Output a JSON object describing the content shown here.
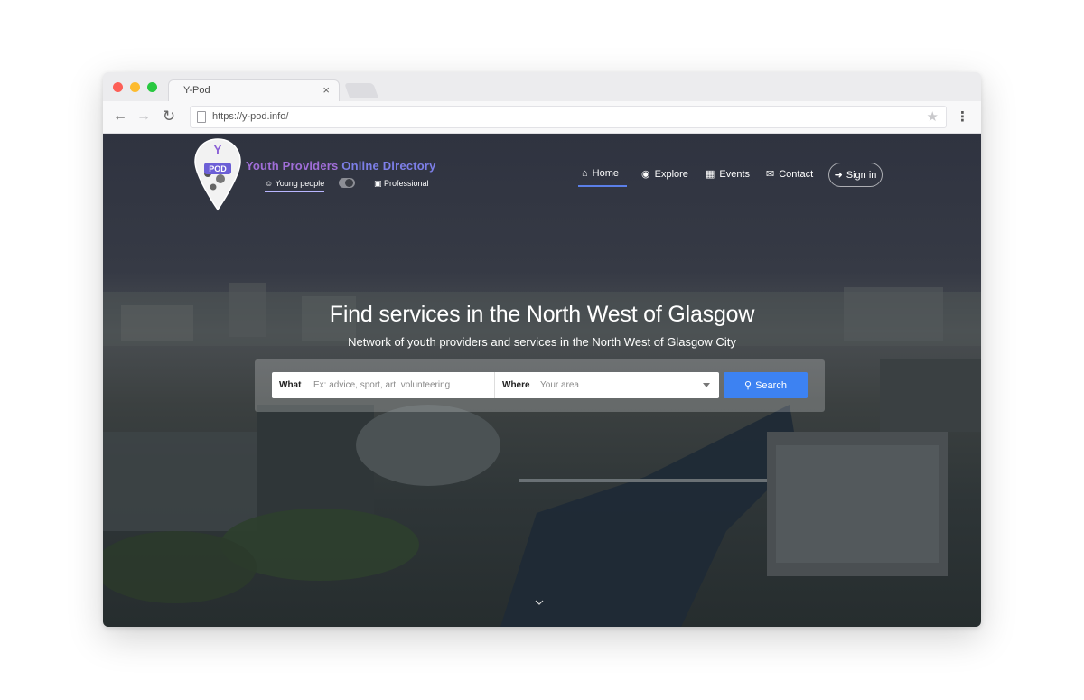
{
  "browser": {
    "tab_title": "Y-Pod",
    "tab_close": "×",
    "url": "https://y-pod.info/",
    "back_icon": "←",
    "forward_icon": "→",
    "reload_icon": "↻",
    "star_icon": "★",
    "menu_icon": "⋮"
  },
  "header": {
    "logo_letters": [
      "Y",
      "POD"
    ],
    "brand_part1": "Youth Providers",
    "brand_part2": " Online Directory",
    "mode_young": "Young people",
    "mode_pro": "Professional",
    "mode_icon_young": "user-icon",
    "mode_icon_pro": "briefcase-icon"
  },
  "nav": {
    "items": [
      {
        "label": "Home",
        "icon": "home-icon",
        "active": true
      },
      {
        "label": "Explore",
        "icon": "map-pin-icon"
      },
      {
        "label": "Events",
        "icon": "calendar-icon"
      },
      {
        "label": "Contact",
        "icon": "mail-icon"
      }
    ],
    "signin": "Sign in"
  },
  "hero": {
    "title": "Find services in the North West of Glasgow",
    "subtitle": "Network of youth providers and services in the North West of Glasgow City"
  },
  "search": {
    "what_label": "What",
    "what_placeholder": "Ex: advice, sport, art, volunteering",
    "where_label": "Where",
    "where_placeholder": "Your area",
    "button": "Search"
  },
  "colors": {
    "accent": "#3d82f2",
    "brand_purple": "#a06ed8",
    "brand_blue": "#7d7fe8",
    "nav_active": "#5b7fe8"
  }
}
